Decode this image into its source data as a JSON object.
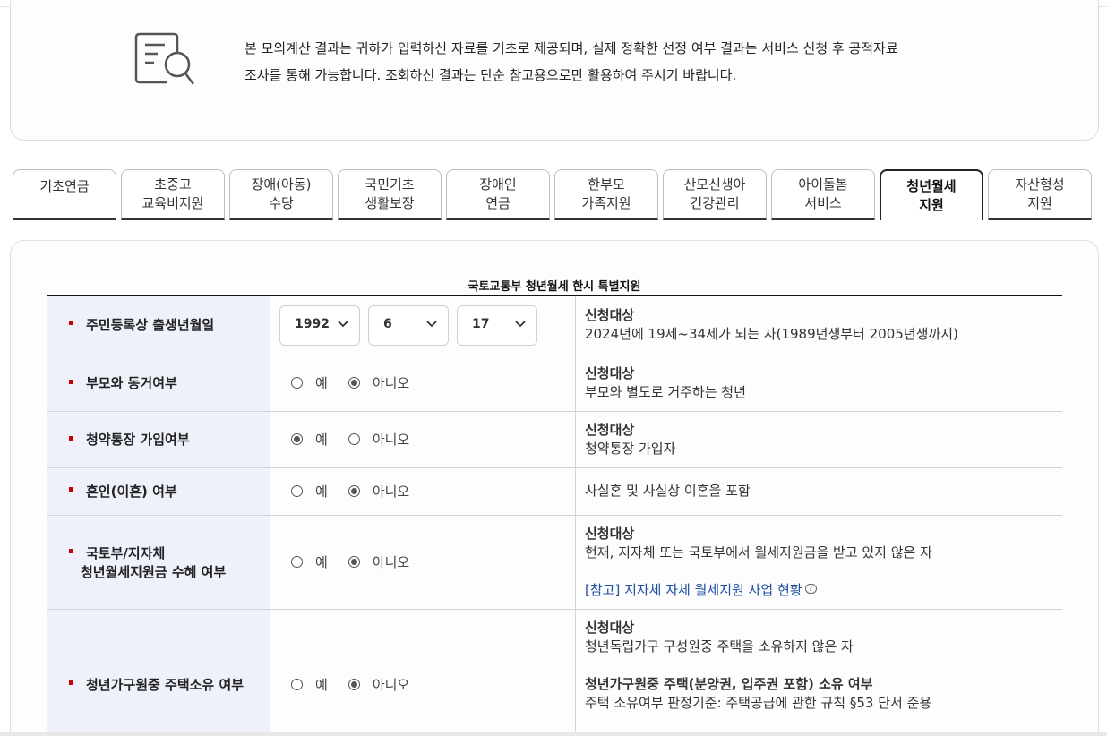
{
  "notice": {
    "icon": "document-search-icon",
    "line1": "본 모의계산 결과는 귀하가 입력하신 자료를 기초로 제공되며, 실제 정확한 선정 여부 결과는 서비스 신청 후 공적자료",
    "line2": "조사를 통해 가능합니다. 조회하신 결과는 단순 참고용으로만 활용하여 주시기 바랍니다."
  },
  "tabs": [
    {
      "label": "기초연금"
    },
    {
      "label": "초중고\n교육비지원"
    },
    {
      "label": "장애(아동)\n수당"
    },
    {
      "label": "국민기초\n생활보장"
    },
    {
      "label": "장애인\n연금"
    },
    {
      "label": "한부모\n가족지원"
    },
    {
      "label": "산모신생아\n건강관리"
    },
    {
      "label": "아이돌봄\n서비스"
    },
    {
      "label": "청년월세\n지원",
      "active": true
    },
    {
      "label": "자산형성\n지원"
    }
  ],
  "table": {
    "title": "국토교통부 청년월세 한시 특별지원",
    "rows": [
      {
        "label": "주민등록상 출생년월일",
        "birth": {
          "year": "1992",
          "month": "6",
          "day": "17"
        },
        "desc_title": "신청대상",
        "desc": "2024년에 19세~34세가 되는 자(1989년생부터 2005년생까지)"
      },
      {
        "label": "부모와 동거여부",
        "yes": "예",
        "no": "아니오",
        "selected": "no",
        "desc_title": "신청대상",
        "desc": "부모와 별도로 거주하는 청년"
      },
      {
        "label": "청약통장 가입여부",
        "yes": "예",
        "no": "아니오",
        "selected": "yes",
        "desc_title": "신청대상",
        "desc": "청약통장 가입자"
      },
      {
        "label": "혼인(이혼) 여부",
        "yes": "예",
        "no": "아니오",
        "selected": "no",
        "desc": "사실혼 및 사실상 이혼을 포함"
      },
      {
        "label_line1": "국토부/지자체",
        "label_line2": "청년월세지원금 수혜 여부",
        "yes": "예",
        "no": "아니오",
        "selected": "no",
        "desc_title": "신청대상",
        "desc": "현재, 지자체 또는 국토부에서 월세지원금을 받고 있지 않은 자",
        "link": "[참고] 지자체 자체 월세지원 사업 현황",
        "link_icon": "question-icon"
      },
      {
        "label": "청년가구원중 주택소유 여부",
        "yes": "예",
        "no": "아니오",
        "selected": "no",
        "desc_title": "신청대상",
        "desc": "청년독립가구 구성원중 주택을 소유하지 않은 자",
        "desc_title2": "청년가구원중 주택(분양권, 입주권 포함) 소유 여부",
        "desc2": "주택 소유여부 판정기준: 주택공급에 관한 규칙 §53 단서 준용"
      }
    ]
  }
}
